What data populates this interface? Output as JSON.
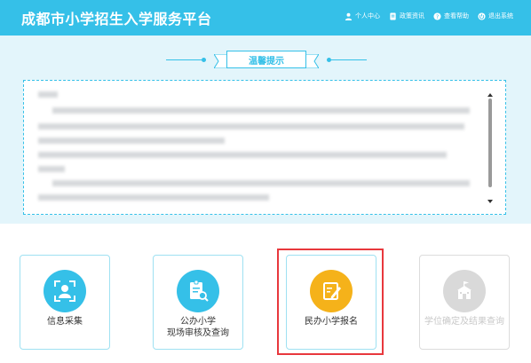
{
  "header": {
    "title": "成都市小学招生入学服务平台",
    "nav": [
      {
        "label": "个人中心",
        "icon": "user-icon"
      },
      {
        "label": "政策资讯",
        "icon": "document-icon"
      },
      {
        "label": "查看帮助",
        "icon": "help-icon"
      },
      {
        "label": "退出系统",
        "icon": "power-icon"
      }
    ]
  },
  "notice": {
    "title": "温馨提示"
  },
  "cards": [
    {
      "label": "信息采集",
      "icon": "user-scan-icon",
      "color": "#35c0e8"
    },
    {
      "label": "公办小学\n现场审核及查询",
      "icon": "document-search-icon",
      "color": "#35c0e8"
    },
    {
      "label": "民办小学报名",
      "icon": "edit-icon",
      "color": "#f5b21a"
    },
    {
      "label": "学位确定及结果查询",
      "icon": "school-icon",
      "color": "#d9d9d9"
    }
  ],
  "colors": {
    "primary": "#35c0e8",
    "accent": "#f5b21a",
    "highlight": "#e8383d"
  }
}
